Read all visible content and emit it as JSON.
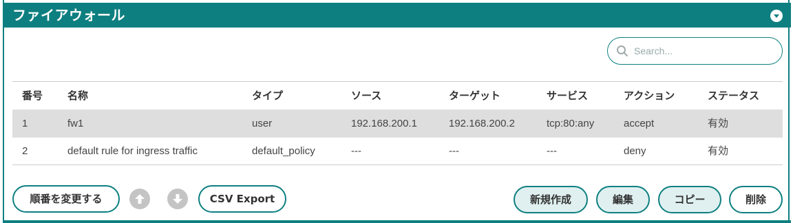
{
  "header": {
    "title": "ファイアウォール"
  },
  "search": {
    "placeholder": "Search..."
  },
  "table": {
    "columns": [
      "番号",
      "名称",
      "タイプ",
      "ソース",
      "ターゲット",
      "サービス",
      "アクション",
      "ステータス"
    ],
    "rows": [
      [
        "1",
        "fw1",
        "user",
        "192.168.200.1",
        "192.168.200.2",
        "tcp:80:any",
        "accept",
        "有効"
      ],
      [
        "2",
        "default rule for ingress traffic",
        "default_policy",
        "---",
        "---",
        "---",
        "deny",
        "有効"
      ]
    ]
  },
  "actions": {
    "reorder_label": "順番を変更する",
    "csv_label": "CSV Export",
    "new_label": "新規作成",
    "edit_label": "編集",
    "copy_label": "コピー",
    "delete_label": "削除"
  },
  "icons": {
    "collapse": "chevron-down-icon",
    "search": "search-icon",
    "up": "arrow-up-icon",
    "down": "arrow-down-icon"
  },
  "colors": {
    "accent": "#0e7f80",
    "selected_row": "#dedede",
    "filled_button": "#e0f0f0"
  }
}
